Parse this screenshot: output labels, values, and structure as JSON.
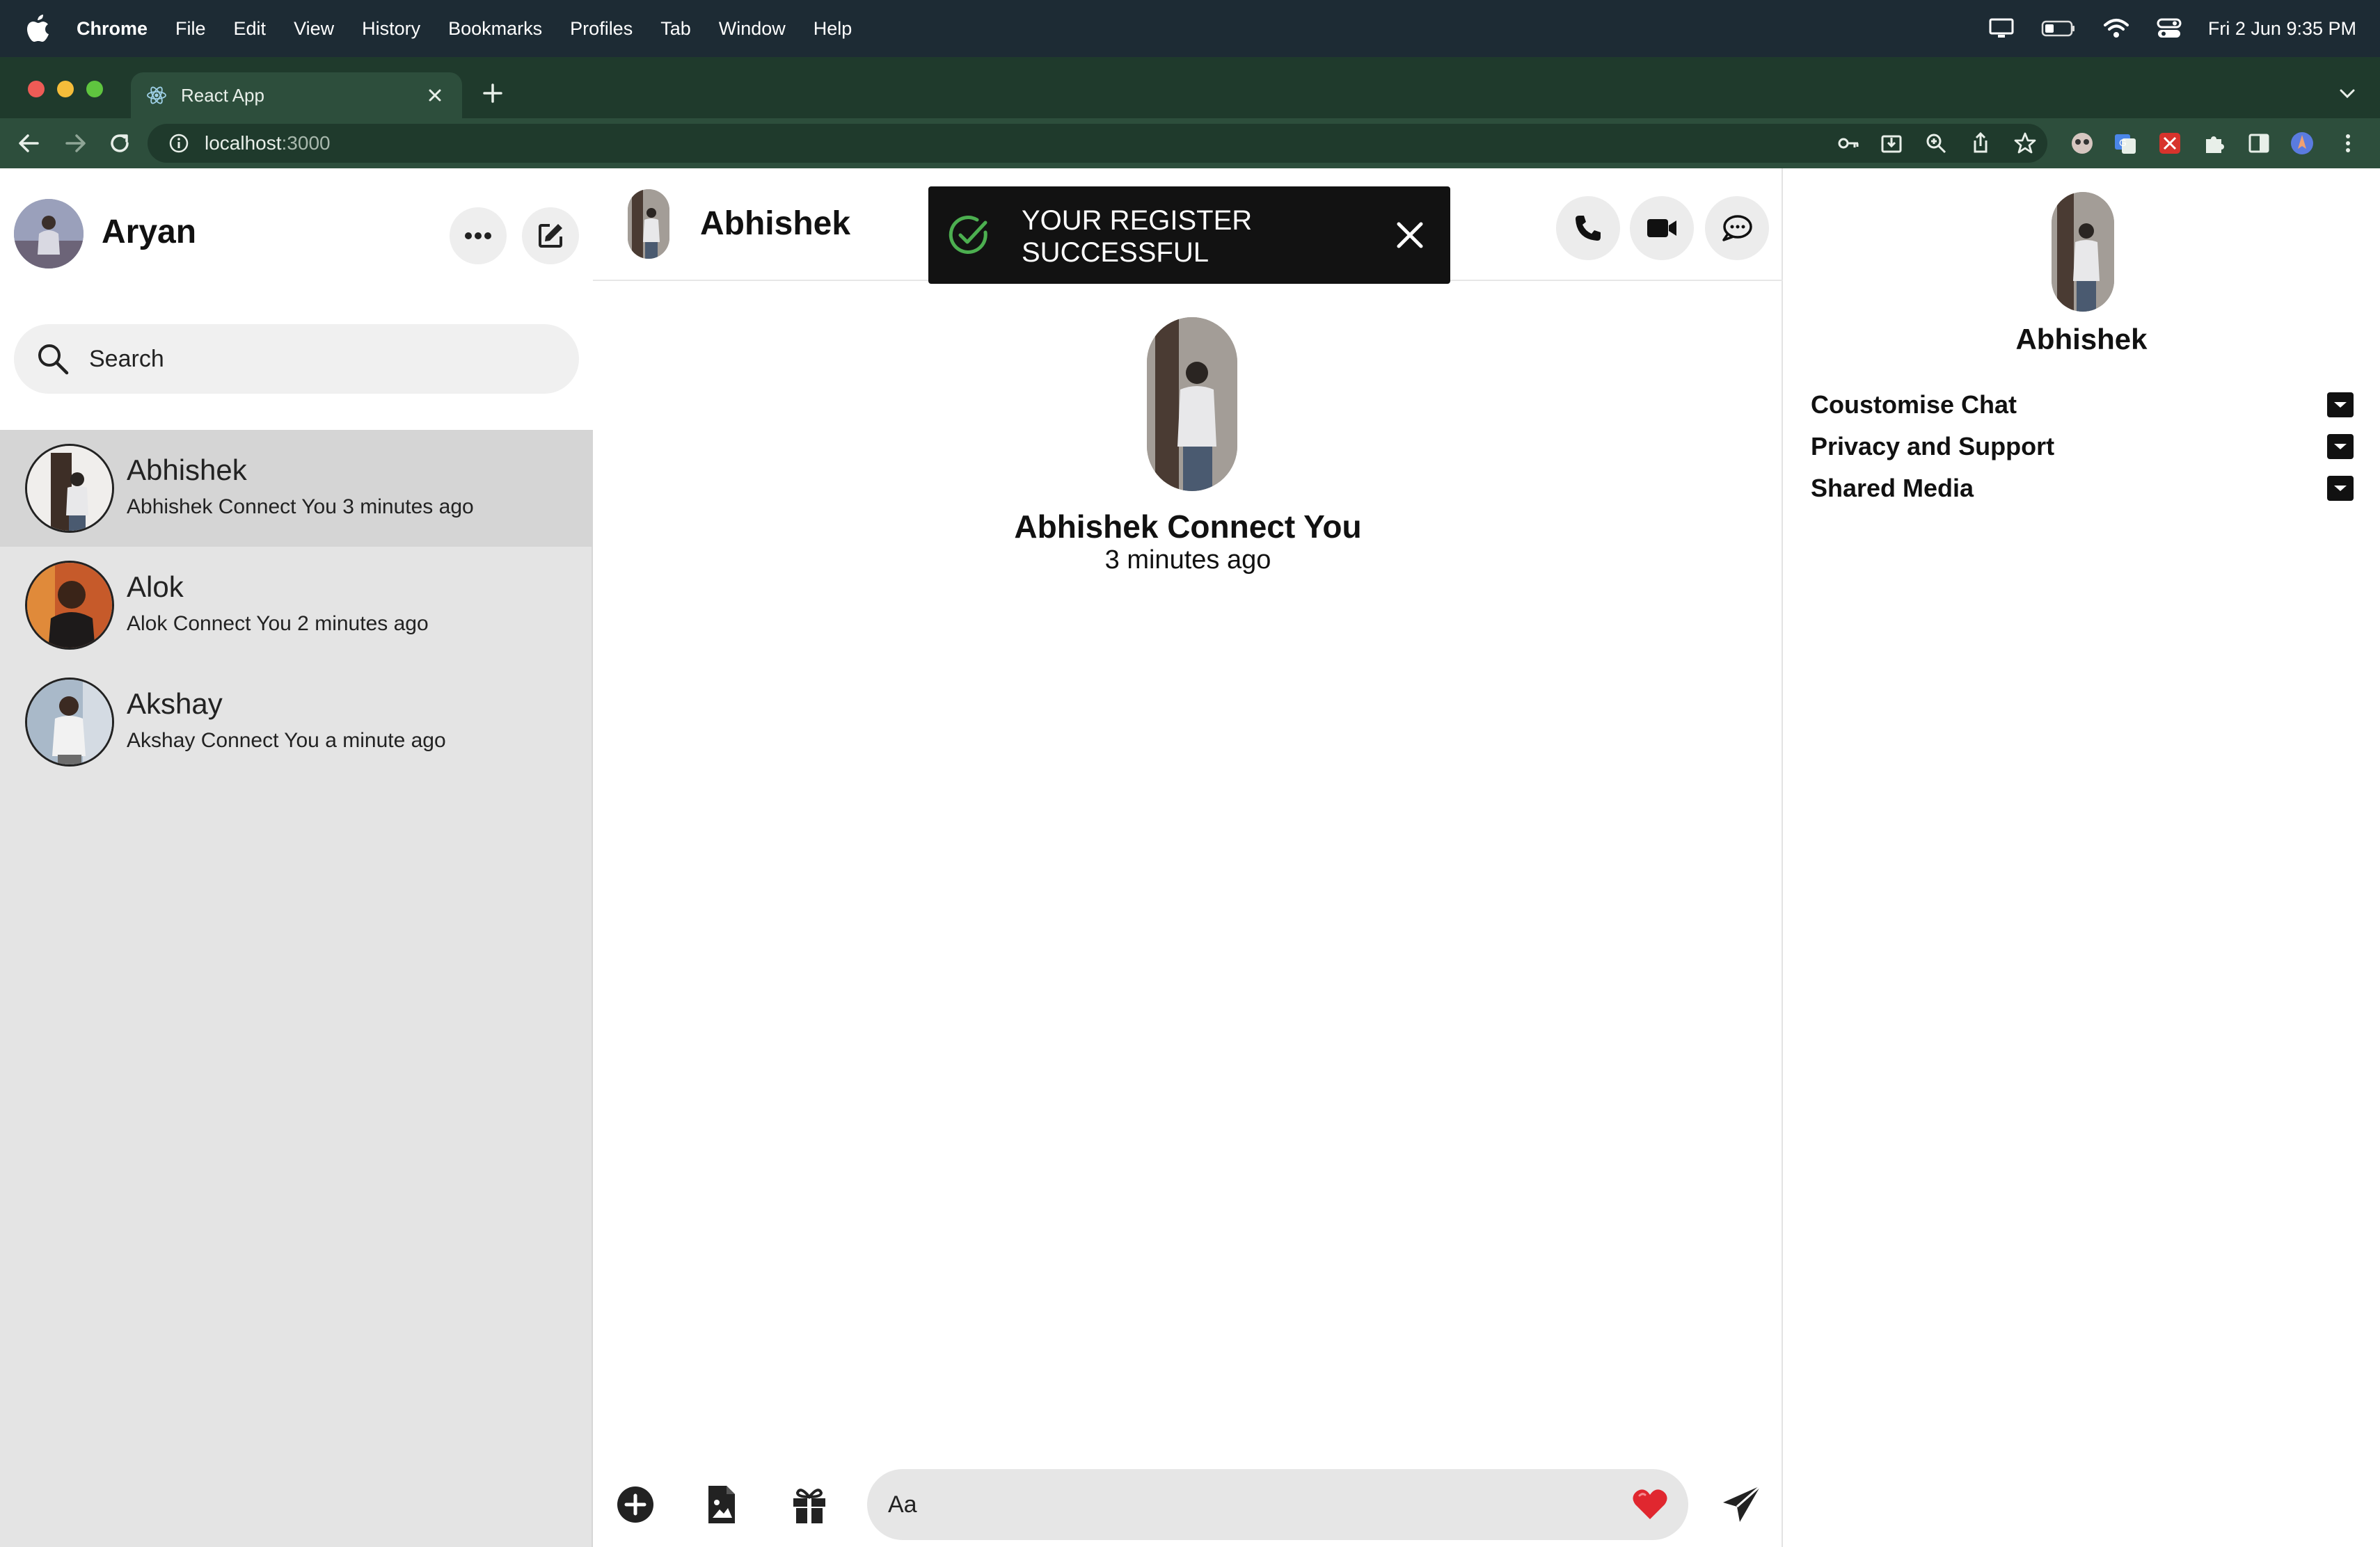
{
  "menubar": {
    "app_name": "Chrome",
    "items": [
      "File",
      "Edit",
      "View",
      "History",
      "Bookmarks",
      "Profiles",
      "Tab",
      "Window",
      "Help"
    ],
    "datetime": "Fri 2 Jun  9:35 PM",
    "status_icons": [
      "display-icon",
      "battery-icon",
      "wifi-icon",
      "control-center-icon"
    ]
  },
  "browser": {
    "tab_title": "React App",
    "url_host": "localhost",
    "url_port": ":3000",
    "toolbar_icons": [
      "key-icon",
      "install-icon",
      "zoom-icon",
      "share-icon",
      "star-icon",
      "extension-1-icon",
      "translate-icon",
      "extension-2-icon",
      "puzzle-icon",
      "sidepanel-icon",
      "profile-icon",
      "kebab-menu-icon"
    ]
  },
  "sidebar": {
    "user_name": "Aryan",
    "search_placeholder": "Search",
    "contacts": [
      {
        "name": "Abhishek",
        "message": "Abhishek Connect You 3 minutes ago",
        "active": true
      },
      {
        "name": "Alok",
        "message": "Alok Connect You 2 minutes ago",
        "active": false
      },
      {
        "name": "Akshay",
        "message": "Akshay Connect You a minute ago",
        "active": false
      }
    ]
  },
  "chat": {
    "header_name": "Abhishek",
    "intro_title": "Abhishek Connect You",
    "intro_time": "3 minutes ago",
    "composer_placeholder": "Aa"
  },
  "right_panel": {
    "name": "Abhishek",
    "sections": [
      "Coustomise Chat",
      "Privacy and Support",
      "Shared Media"
    ]
  },
  "toast": {
    "message": "YOUR REGISTER SUCCESSFUL",
    "type": "success",
    "accent_color": "#4caf50"
  },
  "colors": {
    "menubar_bg": "#1d2b34",
    "chrome_frame": "#1f3a2c",
    "chrome_toolbar": "#2d4e3c",
    "sidebar_bg": "#e4e4e4",
    "active_contact_bg": "#d5d5d5",
    "heart": "#e0272f"
  }
}
